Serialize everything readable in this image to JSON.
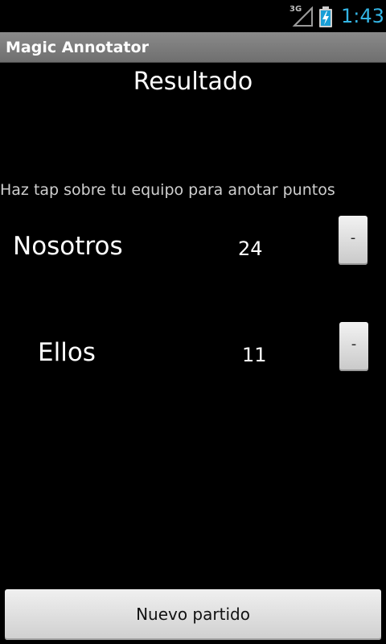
{
  "status_bar": {
    "network_label": "3G",
    "time": "1:43",
    "signal_icon": "cell-signal-icon",
    "battery_icon": "battery-charging-icon",
    "clock_color": "#33b5e5"
  },
  "app": {
    "title": "Magic Annotator"
  },
  "main": {
    "heading": "Resultado",
    "hint": "Haz tap sobre tu equipo para anotar puntos",
    "teams": [
      {
        "name": "Nosotros",
        "score": "24",
        "minus_label": "-"
      },
      {
        "name": "Ellos",
        "score": "11",
        "minus_label": "-"
      }
    ],
    "new_game_label": "Nuevo partido"
  }
}
